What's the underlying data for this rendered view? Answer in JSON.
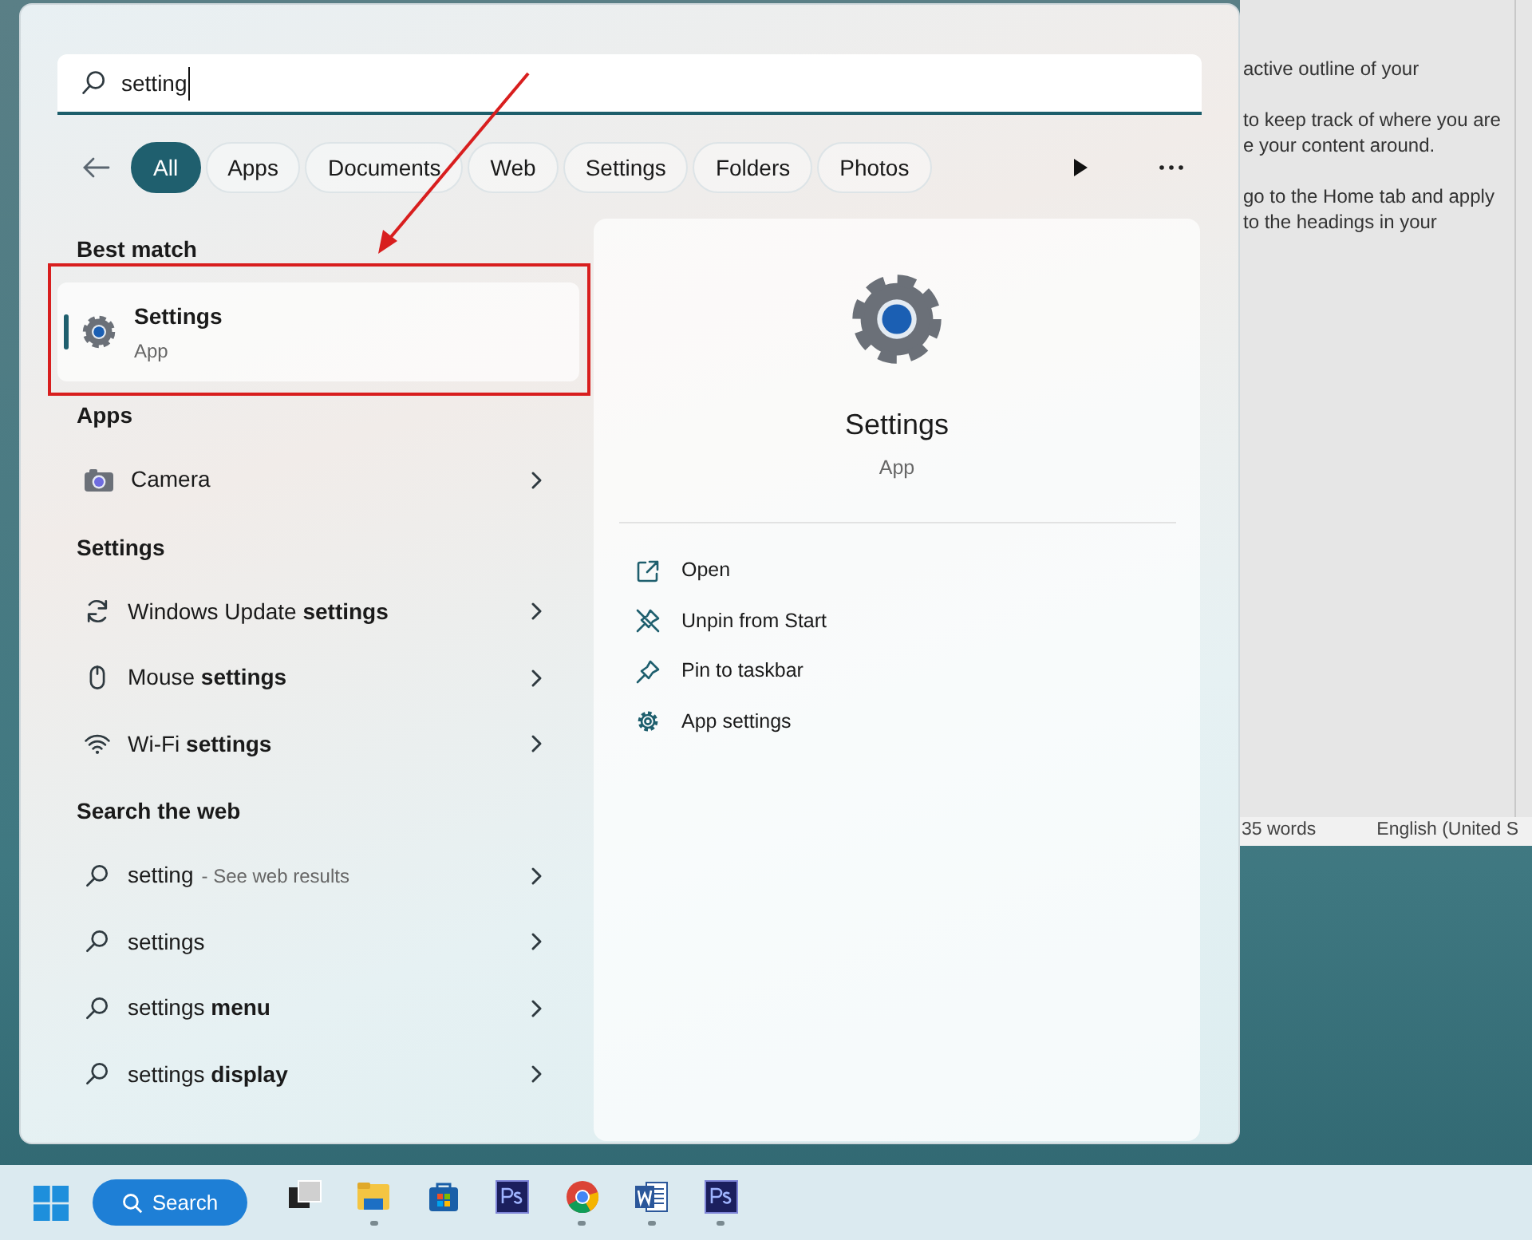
{
  "search": {
    "value": "setting"
  },
  "filters": [
    {
      "label": "All",
      "selected": true
    },
    {
      "label": "Apps",
      "selected": false
    },
    {
      "label": "Documents",
      "selected": false
    },
    {
      "label": "Web",
      "selected": false
    },
    {
      "label": "Settings",
      "selected": false
    },
    {
      "label": "Folders",
      "selected": false
    },
    {
      "label": "Photos",
      "selected": false
    }
  ],
  "best_match": {
    "heading": "Best match",
    "title": "Settings",
    "subtitle": "App",
    "selected": true
  },
  "sections": [
    {
      "heading": "Apps",
      "items": [
        {
          "kind": "app",
          "label": "Camera"
        }
      ]
    },
    {
      "heading": "Settings",
      "items": [
        {
          "kind": "setting",
          "label": "Windows Update **settings**"
        },
        {
          "kind": "setting",
          "label": "Mouse **settings**"
        },
        {
          "kind": "setting",
          "label": "Wi-Fi **settings**"
        }
      ]
    },
    {
      "heading": "Search the web",
      "items": [
        {
          "kind": "web",
          "label": "setting",
          "hint": "- See web results"
        },
        {
          "kind": "web",
          "label": "settings"
        },
        {
          "kind": "web",
          "label": "settings **menu**"
        },
        {
          "kind": "web",
          "label": "settings **display**"
        }
      ]
    }
  ],
  "preview": {
    "title": "Settings",
    "subtitle": "App",
    "actions": [
      "Open",
      "Unpin from Start",
      "Pin to taskbar",
      "App settings"
    ]
  },
  "background_window": {
    "paragraphs": [
      [
        "active outline of your"
      ],
      [
        "to keep track of where you are",
        "e your content around."
      ],
      [
        "go to the Home tab and apply",
        "to the headings in your"
      ]
    ],
    "status": [
      "35 words",
      "English (United S"
    ]
  },
  "taskbar": {
    "search_label": "Search"
  }
}
